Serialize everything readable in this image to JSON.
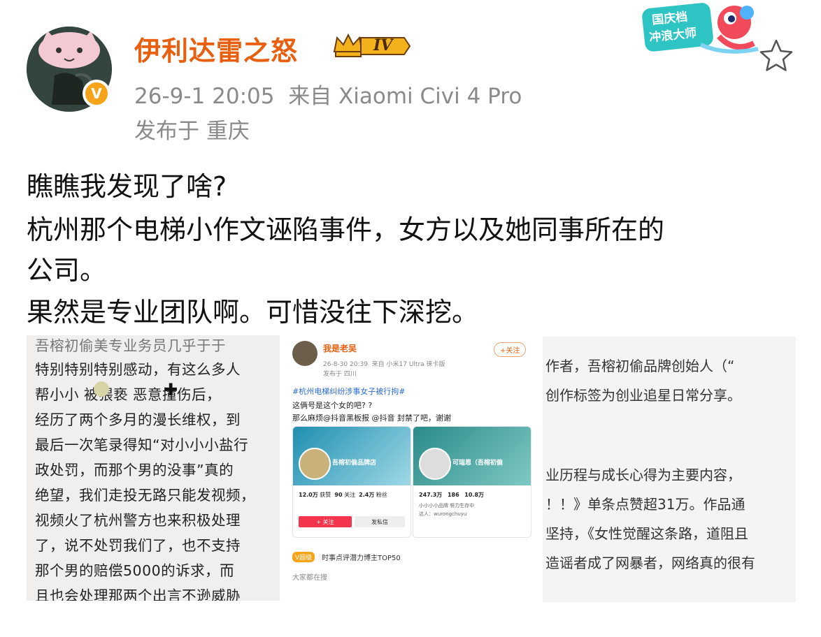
{
  "header": {
    "username": "伊利达雷之怒",
    "level_label": "IV",
    "timestamp": "26-9-1 20:05",
    "source": "来自 Xiaomi Civi 4 Pro",
    "location": "发布于 重庆",
    "verified_badge": "V",
    "campaign_badge_line1": "国庆档",
    "campaign_badge_line2": "冲浪大师"
  },
  "post": {
    "lines": [
      "瞧瞧我发现了啥?",
      "杭州那个电梯小作文诬陷事件，女方以及她同事所在的",
      "公司。",
      "果然是专业团队啊。可惜没往下深挖。"
    ]
  },
  "image1": {
    "lines": [
      "吾榕初偷美专业务员几乎于于",
      "特别特别特别感动，有这么多人",
      "帮小小    被猥亵   恶意撞伤后，",
      "经历了两个多月的漫长维权，到",
      "最后一次笔录得知“对小小小盐行",
      "政处罚，而那个男的没事”真的",
      "绝望，我们走投无路只能发视频，",
      "视频火了杭州警方也来积极处理",
      "了，说不处罚我们了，也不支持",
      "那个男的赔偿5000的诉求，而",
      "且也会处理那两个出言不逊威胁"
    ]
  },
  "image2": {
    "author": "我是老吴",
    "time": "26-8-30 20:39",
    "source": "来自 小米17 Ultra 徕卡版",
    "location": "发布于 四川",
    "follow_label": "+关注",
    "topic": "#杭州电梯纠纷涉事女子被行拘#",
    "q1": "这俩号是这个女的吧? ?",
    "q2": "那么麻烦@抖音黑板报 @抖音 封禁了吧，谢谢",
    "card_left": {
      "name": "吾榕初偷品牌店",
      "stat1": "12.0万",
      "stat1_label": "获赞",
      "stat2": "90",
      "stat2_label": "关注",
      "stat3": "2.4万",
      "stat3_label": "粉丝",
      "follow": "+ 关注",
      "message": "发私信"
    },
    "card_right": {
      "name": "可瑞恩（吾榕初偷",
      "stat1": "247.3万",
      "stat2": "186",
      "stat3": "10.8万",
      "bio1": "小小小小品牌   努力生存中",
      "bio2": "达人：wurongchuyu"
    },
    "tag_badge": "V超级",
    "tag_text": "时事点评潜力博主TOP50",
    "footer": "大家都在搜"
  },
  "image3": {
    "lines": [
      "作者，吾榕初偷品牌创始人（“",
      "创作标签为创业追星日常分享。",
      "",
      "",
      "业历程与成长心得为主要内容，",
      "！！》单条点赞超31万。作品通",
      "坚持，《女性觉醒这条路，道阻且",
      "造谣者成了网暴者，网络真的很有"
    ]
  },
  "colors": {
    "username": "#e8600f",
    "meta": "#8a8a8a",
    "accent_red": "#f5354d",
    "gold": "#f6a51b"
  }
}
